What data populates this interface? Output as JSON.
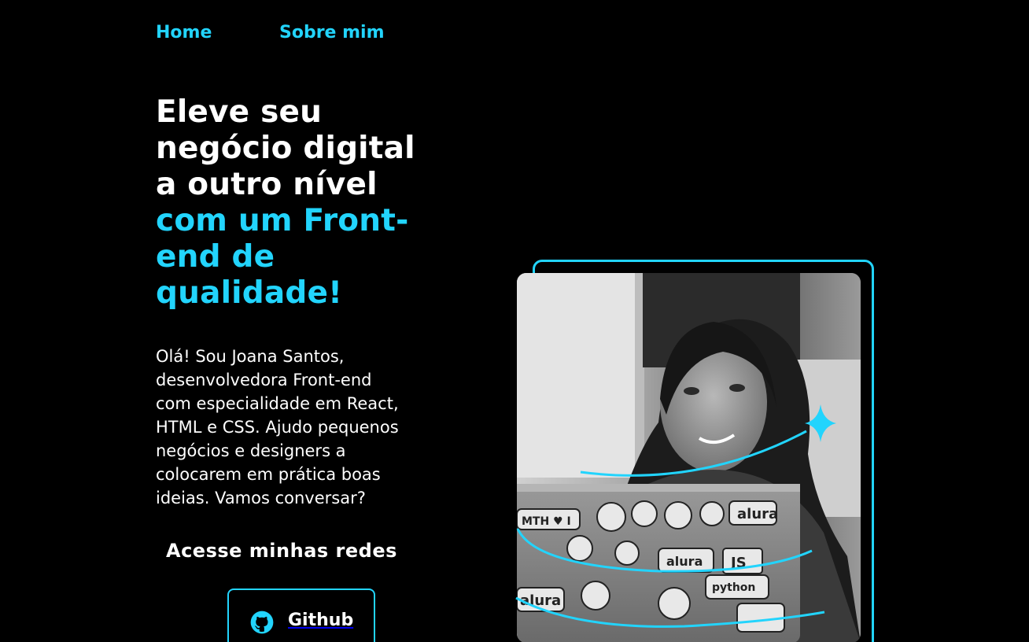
{
  "nav": {
    "home": "Home",
    "about": "Sobre mim"
  },
  "hero": {
    "headline_white": [
      "Eleve seu",
      "negócio digital",
      "a outro nível"
    ],
    "headline_cyan": [
      "com um Front-",
      "end de",
      "qualidade!"
    ],
    "intro_lines": [
      "Olá! Sou Joana Santos,",
      "desenvolvedora Front-end",
      "com especialidade em React,",
      "HTML e CSS. Ajudo pequenos",
      "negócios e designers a",
      "colocarem em prática boas",
      "ideias. Vamos conversar?"
    ],
    "social_title": "Acesse minhas redes",
    "github_label": "Github"
  },
  "colors": {
    "background": "#000000",
    "accent": "#22d4fd",
    "text": "#ffffff"
  },
  "icons": {
    "github": "github-icon",
    "sparkle": "sparkle-icon"
  }
}
